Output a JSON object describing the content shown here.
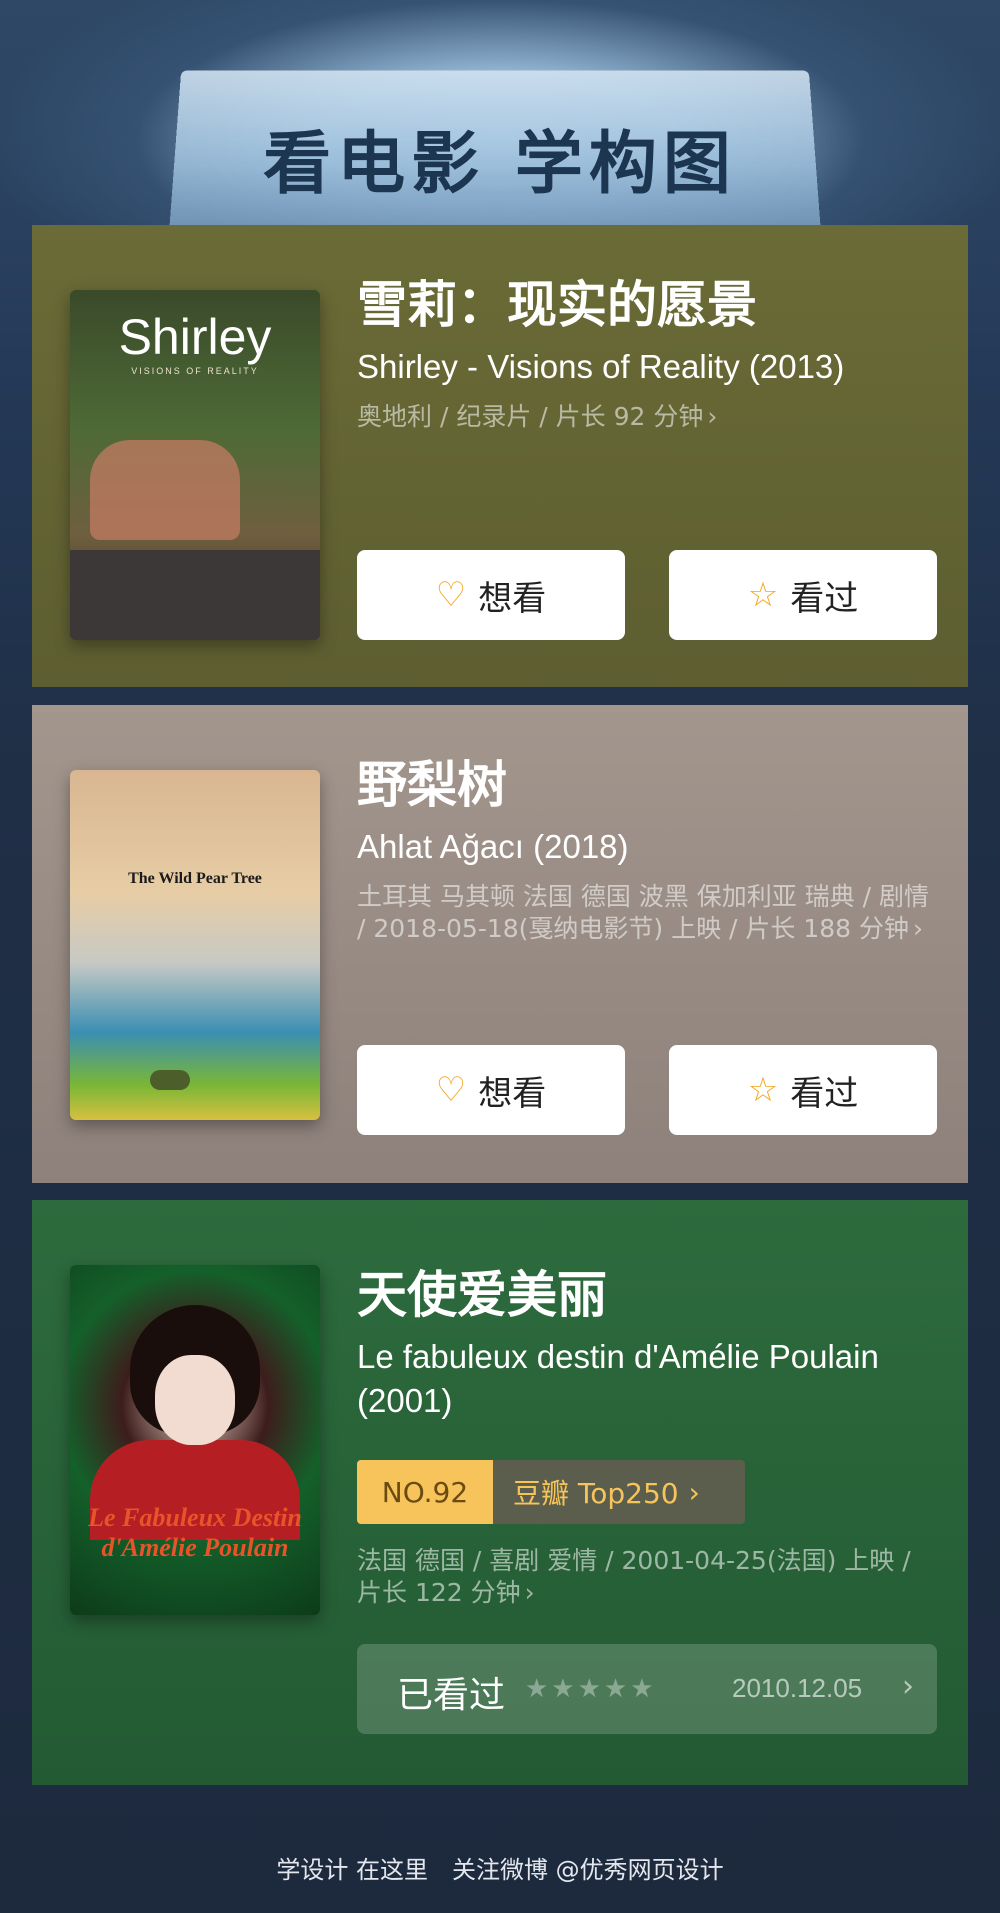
{
  "header": {
    "title": "看电影 学构图"
  },
  "movies": [
    {
      "title_cn": "雪莉：现实的愿景",
      "title_en": "Shirley - Visions of Reality (2013)",
      "meta": "奥地利 / 纪录片 / 片长 92 分钟",
      "poster_title": "Shirley",
      "poster_sub": "VISIONS OF REALITY",
      "want_label": "想看",
      "seen_label": "看过"
    },
    {
      "title_cn": "野梨树",
      "title_en": "Ahlat Ağacı (2018)",
      "meta": "土耳其 马其顿 法国 德国 波黑 保加利亚 瑞典 / 剧情 / 2018-05-18(戛纳电影节) 上映 / 片长 188 分钟",
      "poster_title": "The Wild Pear Tree",
      "want_label": "想看",
      "seen_label": "看过"
    },
    {
      "title_cn": "天使爱美丽",
      "title_en": "Le fabuleux destin d'Amélie Poulain (2001)",
      "rank_no": "NO.92",
      "rank_list": "豆瓣 Top250",
      "meta": "法国 德国 / 喜剧 爱情 / 2001-04-25(法国) 上映 / 片长 122 分钟",
      "poster_title": "Le Fabuleux Destin d'Amélie Poulain",
      "watched_label": "已看过",
      "watched_stars": "★★★★★",
      "watched_date": "2010.12.05"
    }
  ],
  "footer": {
    "text": "学设计 在这里　关注微博 @优秀网页设计"
  },
  "colors": {
    "card1": "#646536",
    "card2": "#998c85",
    "card3": "#2a6539",
    "accent": "#f5a623"
  },
  "icons": {
    "want": "heart-plus-icon",
    "seen": "star-icon",
    "chevron": "chevron-right-icon"
  }
}
